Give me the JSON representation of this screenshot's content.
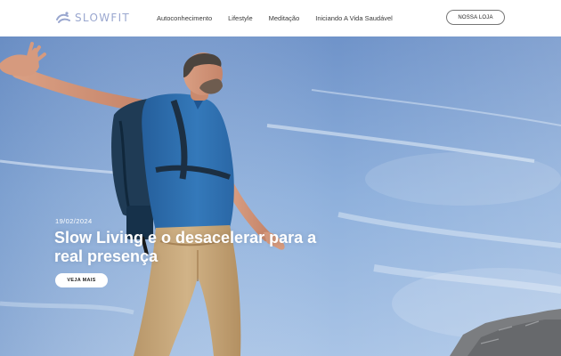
{
  "header": {
    "logo_text": "SLOWFIT",
    "nav": [
      {
        "label": "Autoconhecimento"
      },
      {
        "label": "Lifestyle"
      },
      {
        "label": "Meditação"
      },
      {
        "label": "Iniciando A Vida Saudável"
      }
    ],
    "shop_button": "NOSSA LOJA"
  },
  "hero": {
    "date": "19/02/2024",
    "title": "Slow Living e o desacelerar para a real presença",
    "cta": "VEJA MAIS"
  },
  "colors": {
    "logo": "#9aa7cf",
    "sky": "#7fa3d6",
    "shirt": "#2f6fae",
    "pants": "#c9a97c"
  }
}
